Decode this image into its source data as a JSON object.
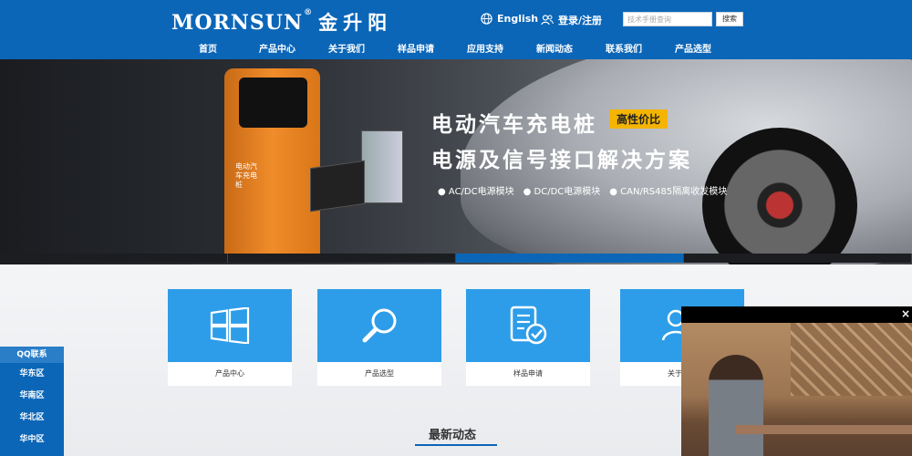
{
  "header": {
    "brand": "MORNSUN",
    "brand_reg": "®",
    "brand_cn": "金升阳",
    "language": "English",
    "login": "登录/注册",
    "search_placeholder": "技术手册查询",
    "search_button": "搜索"
  },
  "nav": [
    "首页",
    "产品中心",
    "关于我们",
    "样品申请",
    "应用支持",
    "新闻动态",
    "联系我们",
    "产品选型"
  ],
  "banner": {
    "title_line1": "电动汽车充电桩",
    "tag": "高性价比",
    "title_line2": "电源及信号接口解决方案",
    "features": [
      "● AC/DC电源模块",
      "● DC/DC电源模块",
      "● CAN/RS485隔离收发模块"
    ],
    "charger_text": "电动汽车充电桩",
    "slides": 4,
    "active_slide": 3
  },
  "cards": [
    {
      "label": "产品中心",
      "icon": "windows-icon"
    },
    {
      "label": "产品选型",
      "icon": "magnifier-icon"
    },
    {
      "label": "样品申请",
      "icon": "document-check-icon"
    },
    {
      "label": "关于我们",
      "icon": "users-icon"
    }
  ],
  "news": {
    "title": "最新动态"
  },
  "sidebar": {
    "title": "QQ联系",
    "items": [
      "华东区",
      "华南区",
      "华北区",
      "华中区"
    ]
  },
  "video": {
    "close": "×"
  },
  "colors": {
    "brand_blue": "#0b66b8",
    "card_blue": "#2d9de9",
    "tag_yellow": "#f4b400"
  }
}
